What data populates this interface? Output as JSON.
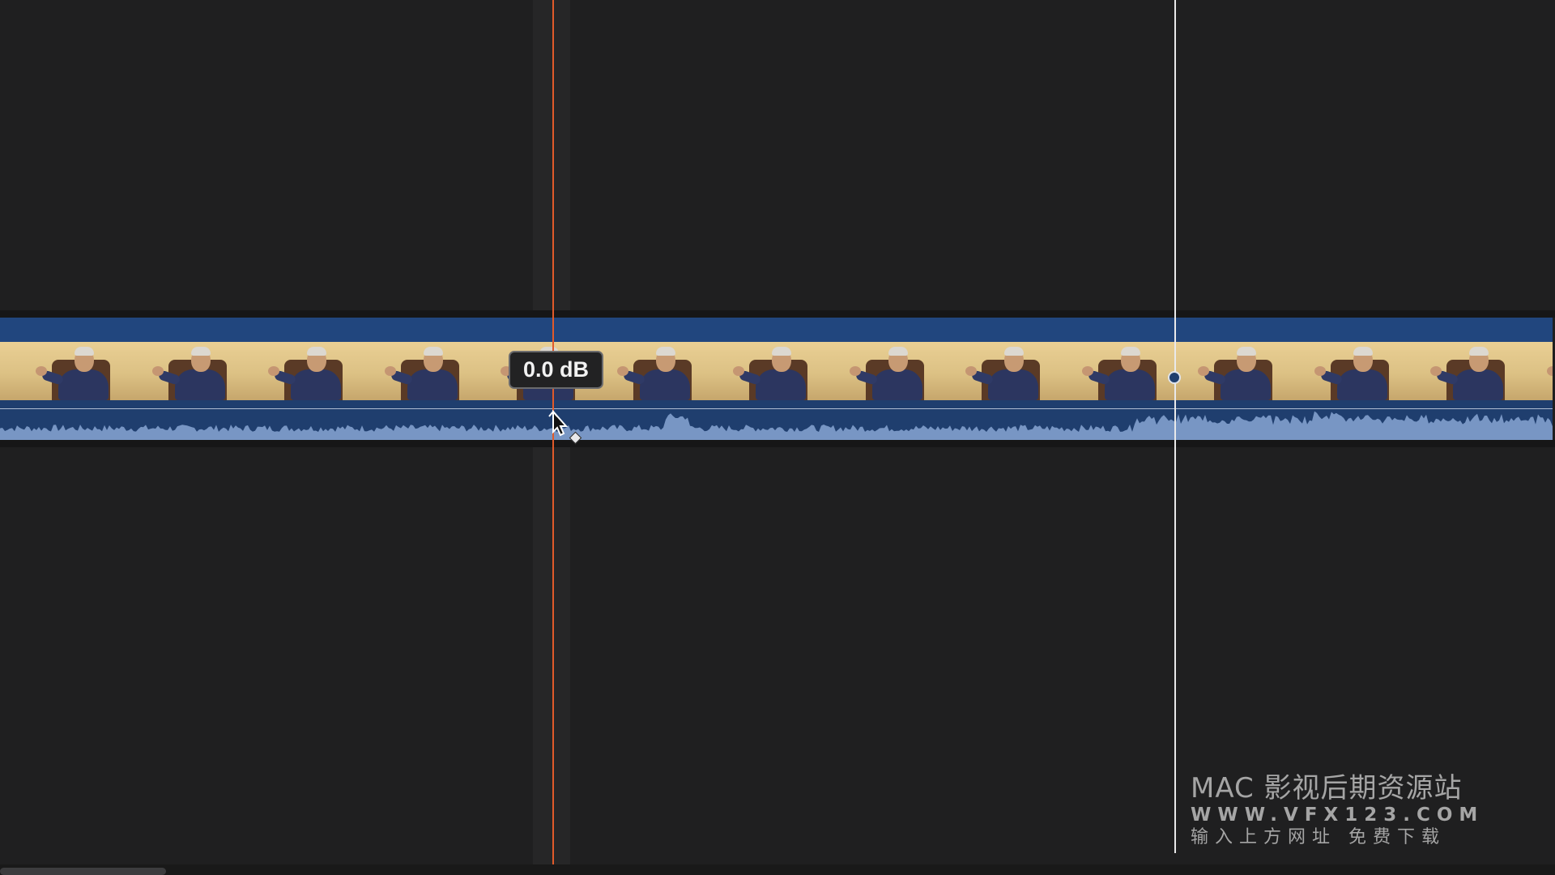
{
  "app": {
    "view": "timeline"
  },
  "clip": {
    "name": "",
    "thumbnail_count": 14,
    "header_color": "#21467e",
    "audio_color": "#1f3e6e",
    "waveform_color": "#7896c4"
  },
  "volume": {
    "value": "0.0 dB"
  },
  "playhead": {
    "color": "#e05a2a"
  },
  "skimmer": {
    "color": "#e9e9ea"
  },
  "icons": {
    "cursor": "arrow-cursor-icon",
    "keyframe": "keyframe-diamond-icon",
    "dot": "keyframe-dot-icon"
  },
  "watermark": {
    "line1": "MAC 影视后期资源站",
    "line2": "WWW.VFX123.COM",
    "line3": "输入上方网址 免费下载"
  }
}
